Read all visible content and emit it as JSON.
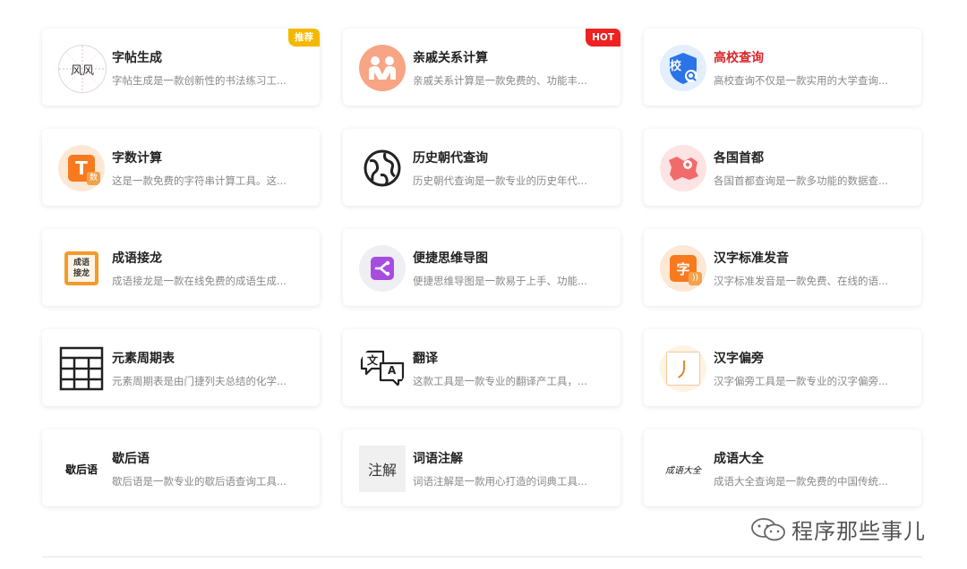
{
  "cards": [
    {
      "title": "字帖生成",
      "desc": "字帖生成是一款创新性的书法练习工...",
      "badge": "推荐",
      "icon": "calligraphy-grid-icon"
    },
    {
      "title": "亲戚关系计算",
      "desc": "亲戚关系计算是一款免费的、功能丰...",
      "badge": "HOT",
      "icon": "family-icon"
    },
    {
      "title": "高校查询",
      "desc": "高校查询不仅是一款实用的大学查询...",
      "icon": "school-shield-icon"
    },
    {
      "title": "字数计算",
      "desc": "这是一款免费的字符串计算工具。这...",
      "icon": "character-count-icon"
    },
    {
      "title": "历史朝代查询",
      "desc": "历史朝代查询是一款专业的历史年代...",
      "icon": "globe-icon"
    },
    {
      "title": "各国首都",
      "desc": "各国首都查询是一款多功能的数据查...",
      "icon": "map-pin-icon"
    },
    {
      "title": "成语接龙",
      "desc": "成语接龙是一款在线免费的成语生成...",
      "icon": "idiom-chain-icon"
    },
    {
      "title": "便捷思维导图",
      "desc": "便捷思维导图是一款易于上手、功能...",
      "icon": "mindmap-icon"
    },
    {
      "title": "汉字标准发音",
      "desc": "汉字标准发音是一款免费、在线的语...",
      "icon": "pronunciation-icon"
    },
    {
      "title": "元素周期表",
      "desc": "元素周期表是由门捷列夫总结的化学...",
      "icon": "periodic-table-icon"
    },
    {
      "title": "翻译",
      "desc": "这款工具是一款专业的翻译产工具，...",
      "icon": "translate-icon"
    },
    {
      "title": "汉字偏旁",
      "desc": "汉字偏旁工具是一款专业的汉字偏旁...",
      "icon": "radical-icon"
    },
    {
      "title": "歇后语",
      "desc": "歇后语是一款专业的歇后语查询工具...",
      "icon": "xiehouyu-icon"
    },
    {
      "title": "词语注解",
      "desc": "词语注解是一款用心打造的词典工具...",
      "icon": "annotation-icon"
    },
    {
      "title": "成语大全",
      "desc": "成语大全查询是一款免费的中国传统...",
      "icon": "idiom-collection-icon"
    }
  ],
  "icon_text": {
    "calligraphy": "风风",
    "char_count": "T",
    "char_count_sub": "数",
    "idiom_chain_top": "成语",
    "idiom_chain_bottom": "接龙",
    "pronounce": "字",
    "school": "校",
    "translate_left": "文",
    "translate_right": "A",
    "radical": "丿",
    "xiehouyu": "歇后语",
    "annotation": "注解",
    "idiom_collection": "成语大全"
  },
  "watermark": "程序那些事儿",
  "colors": {
    "highlight_title": "#d9262b",
    "badge_recommend": "#f5b800",
    "badge_hot": "#ee2222"
  }
}
